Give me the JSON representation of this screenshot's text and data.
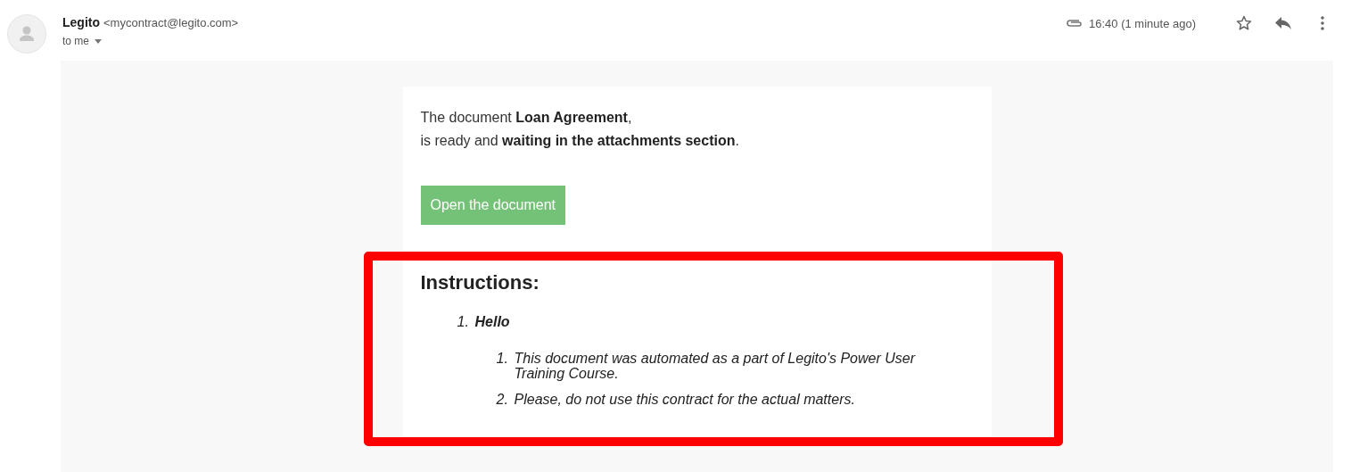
{
  "header": {
    "sender_name": "Legito",
    "sender_email": "<mycontract@legito.com>",
    "recipient": "to me",
    "time": "16:40 (1 minute ago)",
    "has_attachment": true,
    "starred": false
  },
  "message": {
    "lines": [
      "The document **Loan Agreement**,",
      "is ready and **waiting in the attachments section**."
    ],
    "button": "Open the document",
    "instructions_title": "Instructions:",
    "instructions": [
      {
        "number": "1.",
        "text": "Hello",
        "children": [
          {
            "number": "1.",
            "text": "This document was automated as a part of Legito's Power User Training Course."
          },
          {
            "number": "2.",
            "text": "Please, do not use this contract for the actual matters."
          }
        ]
      }
    ]
  }
}
